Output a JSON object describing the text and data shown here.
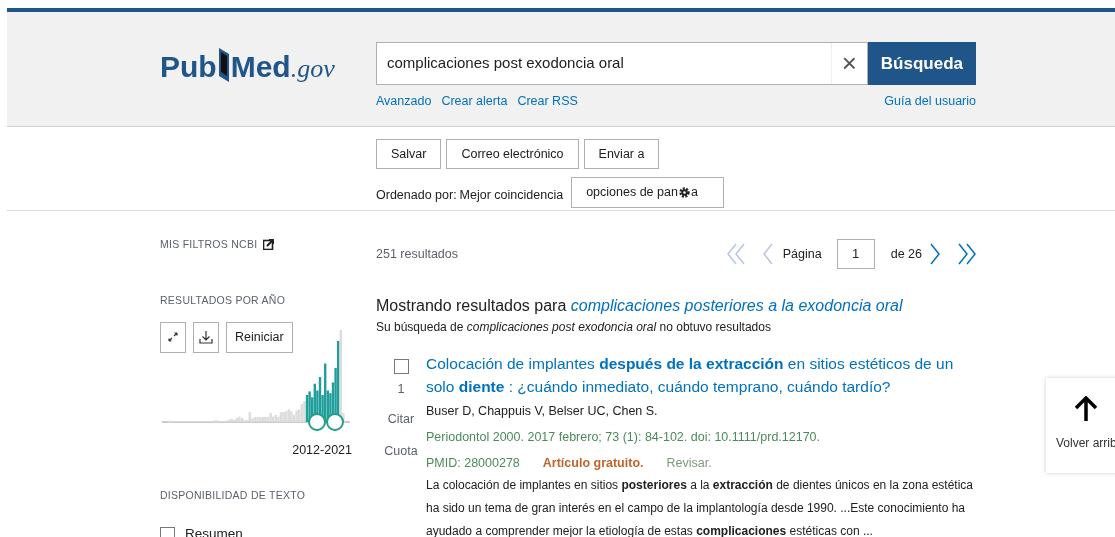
{
  "logo": {
    "text": "Pub",
    "text2": "Med",
    "suffix": ".gov"
  },
  "search": {
    "value": "complicaciones post exodoncia oral",
    "clear": "×",
    "button": "Búsqueda"
  },
  "search_links": [
    "Avanzado",
    "Crear alerta",
    "Crear RSS"
  ],
  "user_guide": "Guía del usuario",
  "actions": [
    "Salvar",
    "Correo electrónico",
    "Enviar a"
  ],
  "sort": {
    "label": "Ordenado por:",
    "value": "Mejor coincidencia"
  },
  "display_options": {
    "label_start": "opciones de pan",
    "label_end": "a"
  },
  "sidebar": {
    "filters_title": "MIS FILTROS NCBI",
    "year_title": "RESULTADOS POR AÑO",
    "reset": "Reiniciar",
    "range": "2012-2021",
    "text_title": "DISPONIBILIDAD DE TEXTO",
    "checks": [
      {
        "label": "Resumen",
        "checked": false
      }
    ]
  },
  "results_count": "251 resultados",
  "pager": {
    "label": "Página",
    "page": "1",
    "of": "de 26"
  },
  "showing": {
    "prefix": "Mostrando resultados para",
    "query": "complicaciones posteriores a la exodoncia oral",
    "note": "Su búsqueda de *complicaciones post exodoncia oral* no obtuvo resultados"
  },
  "results": [
    {
      "number": "1",
      "checked": false,
      "title": "Colocación de implantes **después de la extracción** en sitios estéticos de un solo **diente** : ¿cuándo inmediato, cuándo temprano, cuándo tardío?",
      "cite": "Citar",
      "share": "Cuota",
      "authors": "Buser D, Chappuis V, Belser UC, Chen S.",
      "journal": "Periodontol 2000. 2017 febrero; 73 (1): 84-102. doi: 10.1111/prd.12170.",
      "pmid": "PMID: 28000278",
      "free": "Artículo gratuito.",
      "type": "Revisar.",
      "snippet": "La colocación de implantes en sitios **posteriores** a la **extracción** de dientes únicos en la zona estética ha sido un tema de gran interés en el campo de la implantología desde 1990. ...Este conocimiento ha ayudado a comprender mejor la etiología de estas **complicaciones** estéticas con ..."
    }
  ],
  "back_to_top": "Volver arrib"
}
